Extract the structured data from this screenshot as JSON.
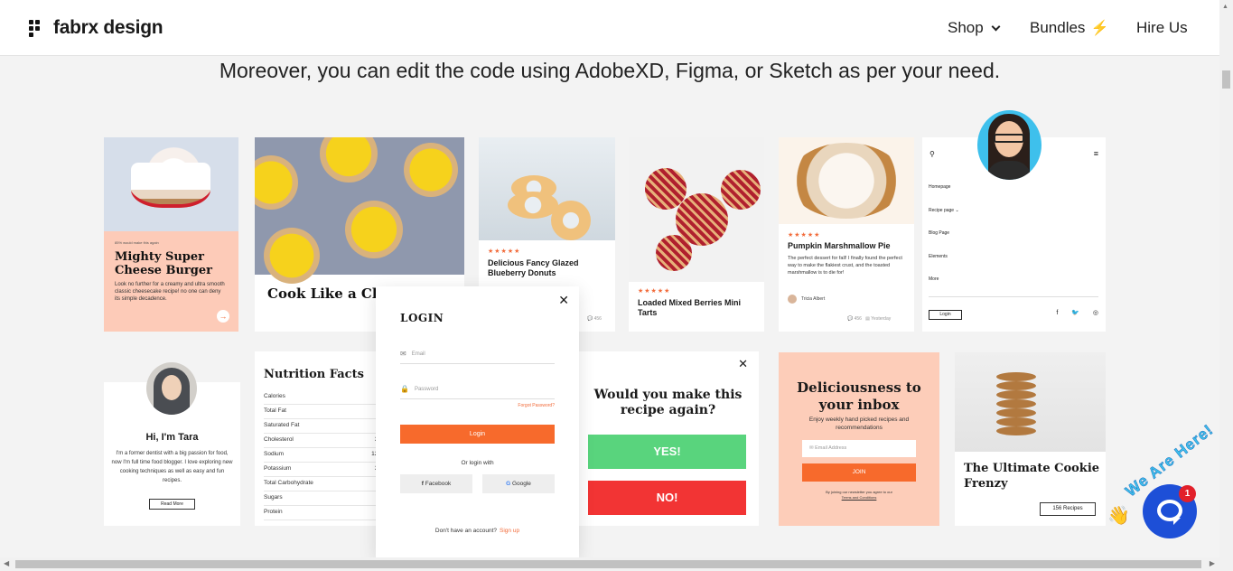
{
  "header": {
    "logo": "fabrx design",
    "nav": {
      "shop": "Shop",
      "bundles": "Bundles",
      "hire": "Hire Us"
    }
  },
  "headline": "Moreover, you can edit the code using AdobeXD, Figma, or Sketch as per your need.",
  "cards": {
    "cheesecake": {
      "tag": "85% would make this again",
      "title": "Mighty Super Cheese Burger",
      "desc": "Look no further for a creamy and ultra smooth classic cheesecake recipe! no one can deny its simple decadence."
    },
    "tarts": {
      "title": "Cook Like a Chef"
    },
    "donuts": {
      "stars": "★★★★★",
      "title": "Delicious Fancy Glazed Blueberry Donuts",
      "comments": "456"
    },
    "pies": {
      "stars": "★★★★★",
      "title": "Loaded Mixed Berries Mini Tarts"
    },
    "pumpkin": {
      "stars": "★★★★★",
      "title": "Pumpkin Marshmallow Pie",
      "desc": "The perfect dessert for fall! I finally found the perfect way to make the flakiest crust, and the toasted marshmallow is to die for!",
      "author": "Tricia Albert",
      "comments": "456",
      "date": "Yesterday"
    },
    "menu": {
      "items": [
        "Homepage",
        "Recipe page",
        "Blog Page",
        "Elements",
        "More"
      ],
      "login": "Login"
    },
    "tara": {
      "title": "Hi, I'm Tara",
      "desc": "I'm a former dentist with a big passion for food, now I'm full time food blogger. I love exploring new cooking techniques as well as easy and fun recipes.",
      "button": "Read More"
    },
    "nutrition": {
      "title": "Nutrition Facts",
      "rows": [
        {
          "label": "Calories",
          "value": ""
        },
        {
          "label": "Total Fat",
          "value": ""
        },
        {
          "label": "Saturated Fat",
          "value": ""
        },
        {
          "label": "Cholesterol",
          "value": "37"
        },
        {
          "label": "Sodium",
          "value": "120"
        },
        {
          "label": "Potassium",
          "value": "32"
        },
        {
          "label": "Total Carbohydrate",
          "value": ""
        },
        {
          "label": "Sugars",
          "value": ""
        },
        {
          "label": "Protein",
          "value": ""
        }
      ]
    },
    "again": {
      "title": "Would you make this recipe again?",
      "yes": "YES!",
      "no": "NO!"
    },
    "newsletter": {
      "title": "Deliciousness to your inbox",
      "desc": "Enjoy weekly hand picked recipes and recommendations",
      "email_placeholder": "Email Address",
      "join": "JOIN",
      "fine": "By joining our newsletter you agree to our",
      "terms": "Terms and Conditions"
    },
    "cookie": {
      "title": "The Ultimate Cookie Frenzy",
      "button": "156 Recipes"
    }
  },
  "login_modal": {
    "title": "LOGIN",
    "email_placeholder": "Email",
    "password_placeholder": "Password",
    "forgot": "Forgot Password?",
    "login": "Login",
    "or": "Or login with",
    "facebook": "Facebook",
    "google": "Google",
    "no_account": "Don't have an account?",
    "signup": "Sign up"
  },
  "chat": {
    "label": "We Are Here!",
    "badge": "1"
  },
  "colors": {
    "accent": "#f76a2c",
    "yes": "#59d47d",
    "no": "#f23434",
    "chat": "#1d4fd7"
  }
}
